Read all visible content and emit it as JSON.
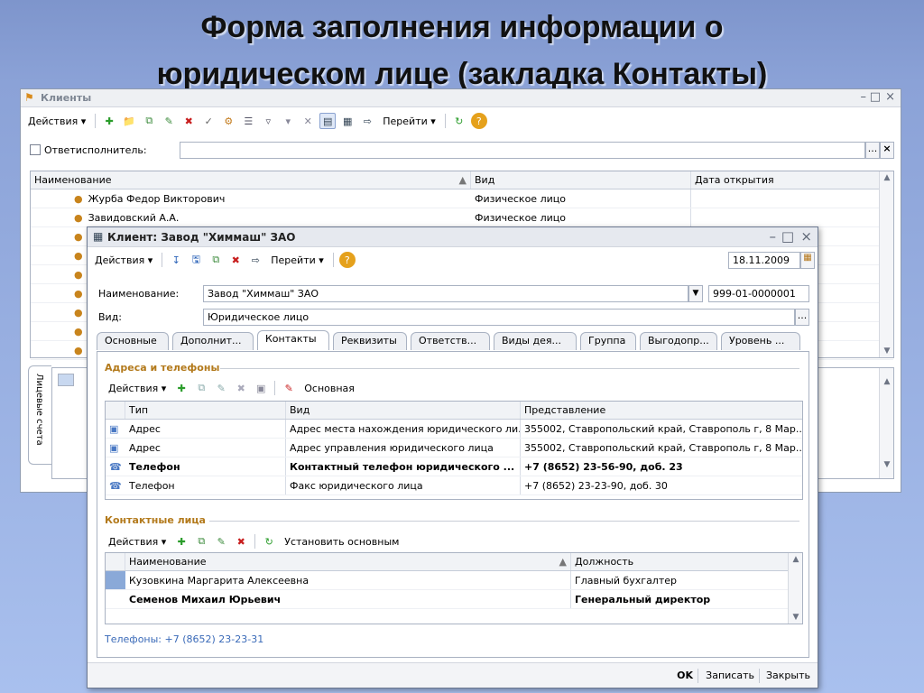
{
  "slide": {
    "title_line1": "Форма заполнения информации о",
    "title_line2": "юридическом лице (закладка Контакты)"
  },
  "back_window": {
    "title": "Клиенты",
    "toolbar": {
      "actions": "Действия",
      "goto": "Перейти"
    },
    "filter": {
      "checkbox_label": "Ответисполнитель:",
      "value": "",
      "clear": "×",
      "browse": "..."
    },
    "columns": [
      "Наименование",
      "Вид",
      "Дата открытия"
    ],
    "rows": [
      {
        "name": "Журба Федор Викторович",
        "kind": "Физическое лицо",
        "date": ""
      },
      {
        "name": "Завидовский А.А.",
        "kind": "Физическое лицо",
        "date": ""
      },
      {
        "name": "",
        "kind": "",
        "date": ""
      },
      {
        "name": "",
        "kind": "",
        "date": ""
      },
      {
        "name": "",
        "kind": "",
        "date": ""
      },
      {
        "name": "",
        "kind": "",
        "date": ""
      },
      {
        "name": "",
        "kind": "",
        "date": ""
      },
      {
        "name": "",
        "kind": "",
        "date": ""
      },
      {
        "name": "",
        "kind": "",
        "date": ""
      }
    ],
    "side_tab": "Лицевые счета"
  },
  "front_window": {
    "title": "Клиент: Завод \"Химмаш\" ЗАО",
    "toolbar": {
      "actions": "Действия",
      "goto": "Перейти",
      "date": "18.11.2009"
    },
    "name_label": "Наименование:",
    "name_value": "Завод \"Химмаш\" ЗАО",
    "code_value": "999-01-0000001",
    "kind_label": "Вид:",
    "kind_value": "Юридическое лицо",
    "tabs": [
      "Основные",
      "Дополнит...",
      "Контакты",
      "Реквизиты",
      "Ответств...",
      "Виды дея...",
      "Группа",
      "Выгодопр...",
      "Уровень ..."
    ],
    "active_tab": "Контакты",
    "addresses": {
      "group_title": "Адреса и телефоны",
      "toolbar": {
        "actions": "Действия",
        "main": "Основная"
      },
      "columns": [
        "Тип",
        "Вид",
        "Представление"
      ],
      "rows": [
        {
          "type": "Адрес",
          "kind": "Адрес места нахождения юридического ли...",
          "value": "355002, Ставропольский край, Ставрополь г, 8 Мар...",
          "bold": false
        },
        {
          "type": "Адрес",
          "kind": "Адрес управления юридического лица",
          "value": "355002, Ставропольский край, Ставрополь г, 8 Мар...",
          "bold": false
        },
        {
          "type": "Телефон",
          "kind": "Контактный телефон юридического ...",
          "value": "+7 (8652) 23-56-90, доб. 23",
          "bold": true
        },
        {
          "type": "Телефон",
          "kind": "Факс юридического лица",
          "value": "+7 (8652) 23-23-90, доб. 30",
          "bold": false
        }
      ]
    },
    "contacts": {
      "group_title": "Контактные лица",
      "toolbar": {
        "actions": "Действия",
        "set_main": "Установить основным"
      },
      "columns": [
        "Наименование",
        "Должность"
      ],
      "rows": [
        {
          "name": "Кузовкина Маргарита Алексеевна",
          "position": "Главный бухгалтер",
          "bold": false
        },
        {
          "name": "Семенов Михаил Юрьевич",
          "position": "Генеральный директор",
          "bold": true
        }
      ],
      "phones": "Телефоны: +7 (8652) 23-23-31"
    },
    "footer": {
      "ok": "OK",
      "save": "Записать",
      "close": "Закрыть"
    }
  }
}
